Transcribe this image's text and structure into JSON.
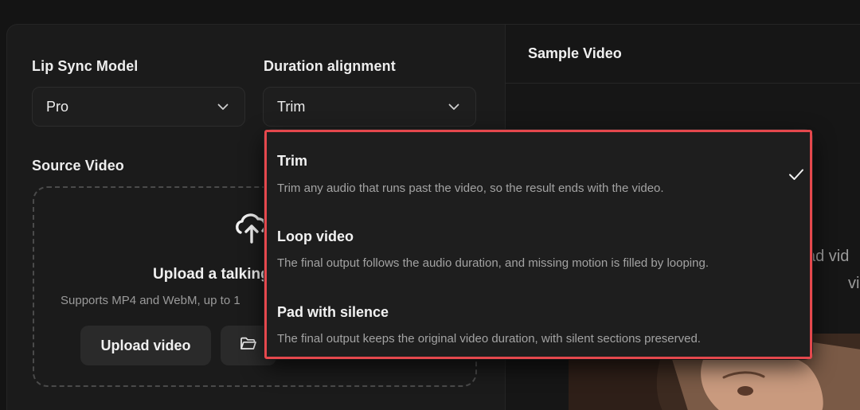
{
  "settings": {
    "lip_sync_model": {
      "label": "Lip Sync Model",
      "value": "Pro"
    },
    "duration_alignment": {
      "label": "Duration alignment",
      "value": "Trim"
    }
  },
  "source_video": {
    "label": "Source Video",
    "upload_title": "Upload a talking",
    "upload_subtitle": "Supports MP4 and WebM, up to 1",
    "upload_button": "Upload video"
  },
  "sample": {
    "title": "Sample Video",
    "partial_text_1": "ad vid",
    "partial_text_2": "vi"
  },
  "dropdown": {
    "selected": "Trim",
    "options": [
      {
        "title": "Trim",
        "description": "Trim any audio that runs past the video, so the result ends with the video.",
        "selected": true
      },
      {
        "title": "Loop video",
        "description": "The final output follows the audio duration, and missing motion is filled by looping.",
        "selected": false
      },
      {
        "title": "Pad with silence",
        "description": "The final output keeps the original video duration, with silent sections preserved.",
        "selected": false
      }
    ]
  },
  "colors": {
    "background": "#141414",
    "panel": "#1b1b1b",
    "menu": "#1e1e1e",
    "highlight": "#e5484d",
    "text_primary": "#f0f0f0",
    "text_secondary": "#a3a3a3"
  },
  "icons": {
    "select_arrow": "chevron-down-icon",
    "upload": "cloud-upload-icon",
    "folder": "folder-open-icon",
    "selected_mark": "checkmark-icon"
  }
}
